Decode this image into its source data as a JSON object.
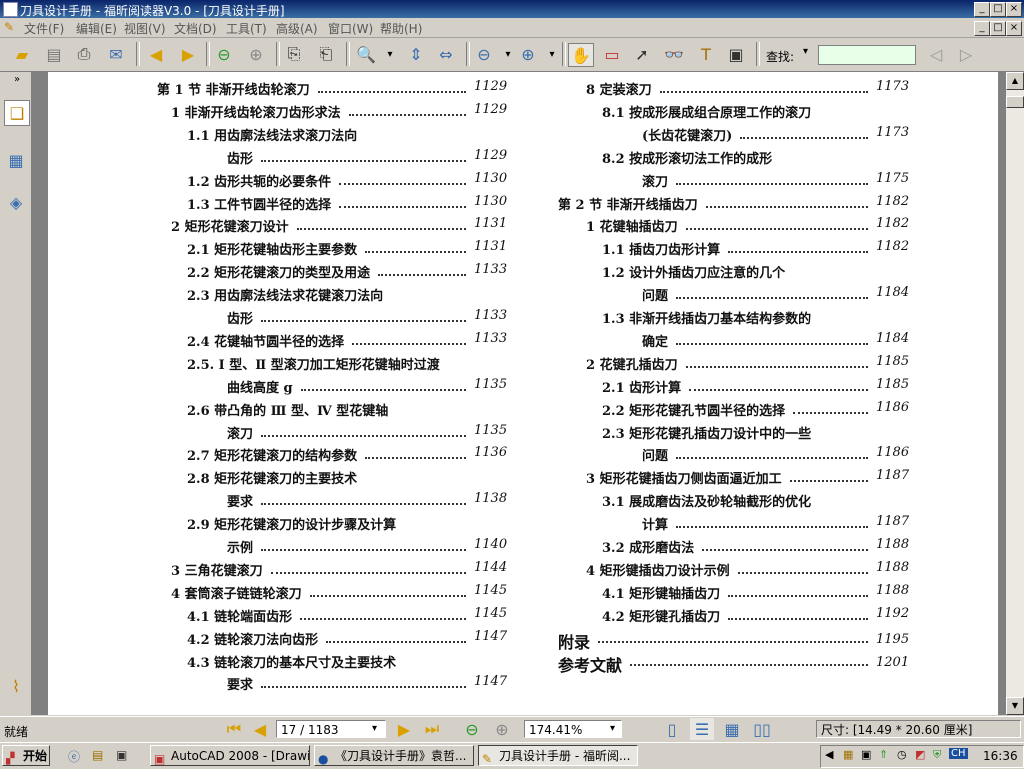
{
  "window": {
    "title": "刀具设计手册 - 福昕阅读器V3.0 - [刀具设计手册]",
    "buttons": [
      "_",
      "□",
      "×"
    ]
  },
  "menu": {
    "items": [
      "文件(F)",
      "编辑(E)",
      "视图(V)",
      "文档(D)",
      "工具(T)",
      "高级(A)",
      "窗口(W)",
      "帮助(H)"
    ]
  },
  "toolbar": {
    "find_label": "查找:",
    "find_value": "",
    "icons": [
      "open-icon",
      "save-icon",
      "print-icon",
      "email-icon",
      "prev-page-icon",
      "next-page-icon",
      "back-icon",
      "forward-icon",
      "rotate-left-icon",
      "rotate-right-icon",
      "zoom-in-icon",
      "fit-page-icon",
      "fit-width-icon",
      "zoom-out-minus-icon",
      "zoom-in-plus-icon",
      "hand-tool-icon",
      "snapshot-icon",
      "select-icon",
      "find-binoculars-icon",
      "text-select-icon",
      "camera-icon"
    ]
  },
  "toc_left": [
    {
      "label": "第 1 节   非渐开线齿轮滚刀",
      "page": "1129"
    },
    {
      "label": "1   非渐开线齿轮滚刀齿形求法",
      "page": "1129"
    },
    {
      "label": "1.1   用齿廓法线法求滚刀法向",
      "page": ""
    },
    {
      "label": "齿形",
      "page": "1129"
    },
    {
      "label": "1.2   齿形共轭的必要条件",
      "page": "1130"
    },
    {
      "label": "1.3   工件节圆半径的选择",
      "page": "1130"
    },
    {
      "label": "2   矩形花键滚刀设计",
      "page": "1131"
    },
    {
      "label": "2.1   矩形花键轴齿形主要参数",
      "page": "1131"
    },
    {
      "label": "2.2   矩形花键滚刀的类型及用途",
      "page": "1133"
    },
    {
      "label": "2.3   用齿廓法线法求花键滚刀法向",
      "page": ""
    },
    {
      "label": "齿形",
      "page": "1133"
    },
    {
      "label": "2.4   花键轴节圆半径的选择",
      "page": "1133"
    },
    {
      "label": "2.5.   Ⅰ 型、Ⅱ 型滚刀加工矩形花键轴时过渡",
      "page": ""
    },
    {
      "label": "曲线高度 g",
      "page": "1135"
    },
    {
      "label": "2.6   带凸角的 Ⅲ 型、Ⅳ 型花键轴",
      "page": ""
    },
    {
      "label": "滚刀",
      "page": "1135"
    },
    {
      "label": "2.7   矩形花键滚刀的结构参数",
      "page": "1136"
    },
    {
      "label": "2.8   矩形花键滚刀的主要技术",
      "page": ""
    },
    {
      "label": "要求",
      "page": "1138"
    },
    {
      "label": "2.9   矩形花键滚刀的设计步骤及计算",
      "page": ""
    },
    {
      "label": "示例",
      "page": "1140"
    },
    {
      "label": "3   三角花键滚刀",
      "page": "1144"
    },
    {
      "label": "4   套筒滚子链链轮滚刀",
      "page": "1145"
    },
    {
      "label": "4.1   链轮端面齿形",
      "page": "1145"
    },
    {
      "label": "4.2   链轮滚刀法向齿形",
      "page": "1147"
    },
    {
      "label": "4.3   链轮滚刀的基本尺寸及主要技术",
      "page": ""
    },
    {
      "label": "要求",
      "page": "1147"
    }
  ],
  "toc_right": [
    {
      "label": "8   定装滚刀",
      "page": "1173"
    },
    {
      "label": "8.1   按成形展成组合原理工作的滚刀",
      "page": ""
    },
    {
      "label": "(长齿花键滚刀)",
      "page": "1173"
    },
    {
      "label": "8.2   按成形滚切法工作的成形",
      "page": ""
    },
    {
      "label": "滚刀",
      "page": "1175"
    },
    {
      "label": "第 2 节   非渐开线插齿刀",
      "page": "1182"
    },
    {
      "label": "1   花键轴插齿刀",
      "page": "1182"
    },
    {
      "label": "1.1   插齿刀齿形计算",
      "page": "1182"
    },
    {
      "label": "1.2   设计外插齿刀应注意的几个",
      "page": ""
    },
    {
      "label": "问题",
      "page": "1184"
    },
    {
      "label": "1.3   非渐开线插齿刀基本结构参数的",
      "page": ""
    },
    {
      "label": "确定",
      "page": "1184"
    },
    {
      "label": "2   花键孔插齿刀",
      "page": "1185"
    },
    {
      "label": "2.1   齿形计算",
      "page": "1185"
    },
    {
      "label": "2.2   矩形花键孔节圆半径的选择",
      "page": "1186"
    },
    {
      "label": "2.3   矩形花键孔插齿刀设计中的一些",
      "page": ""
    },
    {
      "label": "问题",
      "page": "1186"
    },
    {
      "label": "3   矩形花键插齿刀侧齿面逼近加工",
      "page": "1187"
    },
    {
      "label": "3.1   展成磨齿法及砂轮轴截形的优化",
      "page": ""
    },
    {
      "label": "计算",
      "page": "1187"
    },
    {
      "label": "3.2   成形磨齿法",
      "page": "1188"
    },
    {
      "label": "4   矩形键插齿刀设计示例",
      "page": "1188"
    },
    {
      "label": "4.1   矩形键轴插齿刀",
      "page": "1188"
    },
    {
      "label": "4.2   矩形键孔插齿刀",
      "page": "1192"
    },
    {
      "label": "附录",
      "page": "1195"
    },
    {
      "label": "参考文献",
      "page": "1201"
    }
  ],
  "status": {
    "ready": "就绪",
    "page_indicator": "17 / 1183",
    "zoom": "174.41%",
    "size": "尺寸: [14.49 * 20.60 厘米]"
  },
  "taskbar": {
    "start": "开始",
    "tasks": [
      "AutoCAD 2008 - [Drawing...",
      "《刀具设计手册》袁哲...",
      "刀具设计手册 - 福昕阅..."
    ],
    "tray_ime": "CH",
    "clock": "16:36"
  }
}
